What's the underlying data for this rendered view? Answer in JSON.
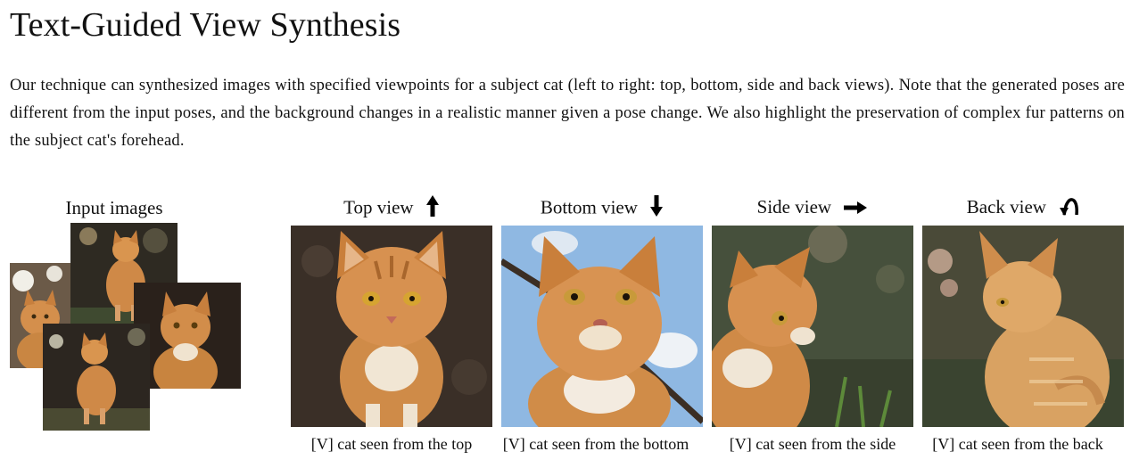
{
  "header": {
    "title": "Text-Guided View Synthesis",
    "description": "Our technique can synthesized images with specified viewpoints for a subject cat (left to right: top, bottom, side and back views). Note that the generated poses are different from the input poses, and the background changes in a realistic manner given a pose change. We also highlight the preservation of complex fur patterns on the subject cat's forehead."
  },
  "input": {
    "label": "Input images"
  },
  "views": [
    {
      "label": "Top view",
      "arrow": "up-arrow-icon",
      "caption": "[V] cat seen from the top"
    },
    {
      "label": "Bottom view",
      "arrow": "down-arrow-icon",
      "caption": "[V] cat seen from the bottom"
    },
    {
      "label": "Side view",
      "arrow": "right-arrow-icon",
      "caption": "[V] cat seen from the side"
    },
    {
      "label": "Back view",
      "arrow": "curved-back-arrow-icon",
      "caption": "[V] cat seen from the back"
    }
  ],
  "colors": {
    "fur": "#d08a45",
    "fur_light": "#e9b57a",
    "sky": "#9fc3e6",
    "ground_dark": "#3b3028",
    "foliage": "#3f4a34"
  }
}
